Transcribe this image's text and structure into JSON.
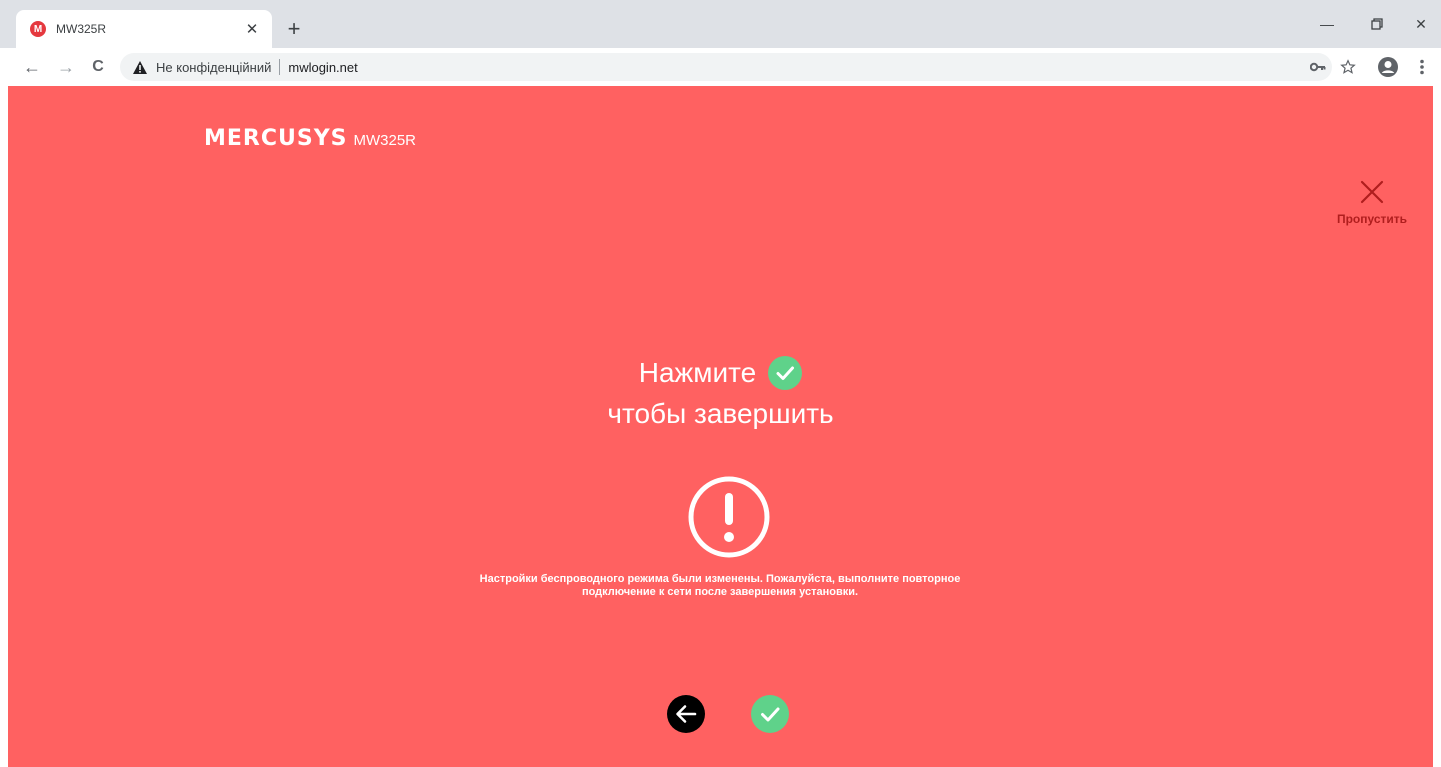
{
  "browser": {
    "tab": {
      "favicon_letter": "M",
      "title": "MW325R",
      "close_glyph": "✕"
    },
    "new_tab_glyph": "+",
    "window_controls": {
      "minimize": "—",
      "restore": "❐",
      "close": "✕"
    },
    "nav": {
      "back": "←",
      "forward": "→",
      "reload": "C"
    },
    "omnibox": {
      "security_label": "Не конфіденційний",
      "url": "mwlogin.net"
    },
    "toolbar_icons": [
      "key-icon",
      "star-icon",
      "profile-icon",
      "menu-icon"
    ]
  },
  "page": {
    "background_color": "#ff6161",
    "logo": {
      "brand": "MERCUSYS",
      "model": "MW325R"
    },
    "skip": {
      "label": "Пропустить",
      "icon": "close-icon",
      "color": "#b01e1e"
    },
    "headline": {
      "line1": "Нажмите",
      "line2": "чтобы завершить"
    },
    "alert_icon": "exclamation-circle-icon",
    "message": {
      "line1": "Настройки беспроводного режима были изменены. Пожалуйста, выполните повторное",
      "line2": "подключение к сети после завершения установки."
    },
    "buttons": {
      "back": {
        "icon": "arrow-left-icon",
        "color": "#000000"
      },
      "finish": {
        "icon": "check-icon",
        "color": "#5fd28a"
      }
    }
  }
}
